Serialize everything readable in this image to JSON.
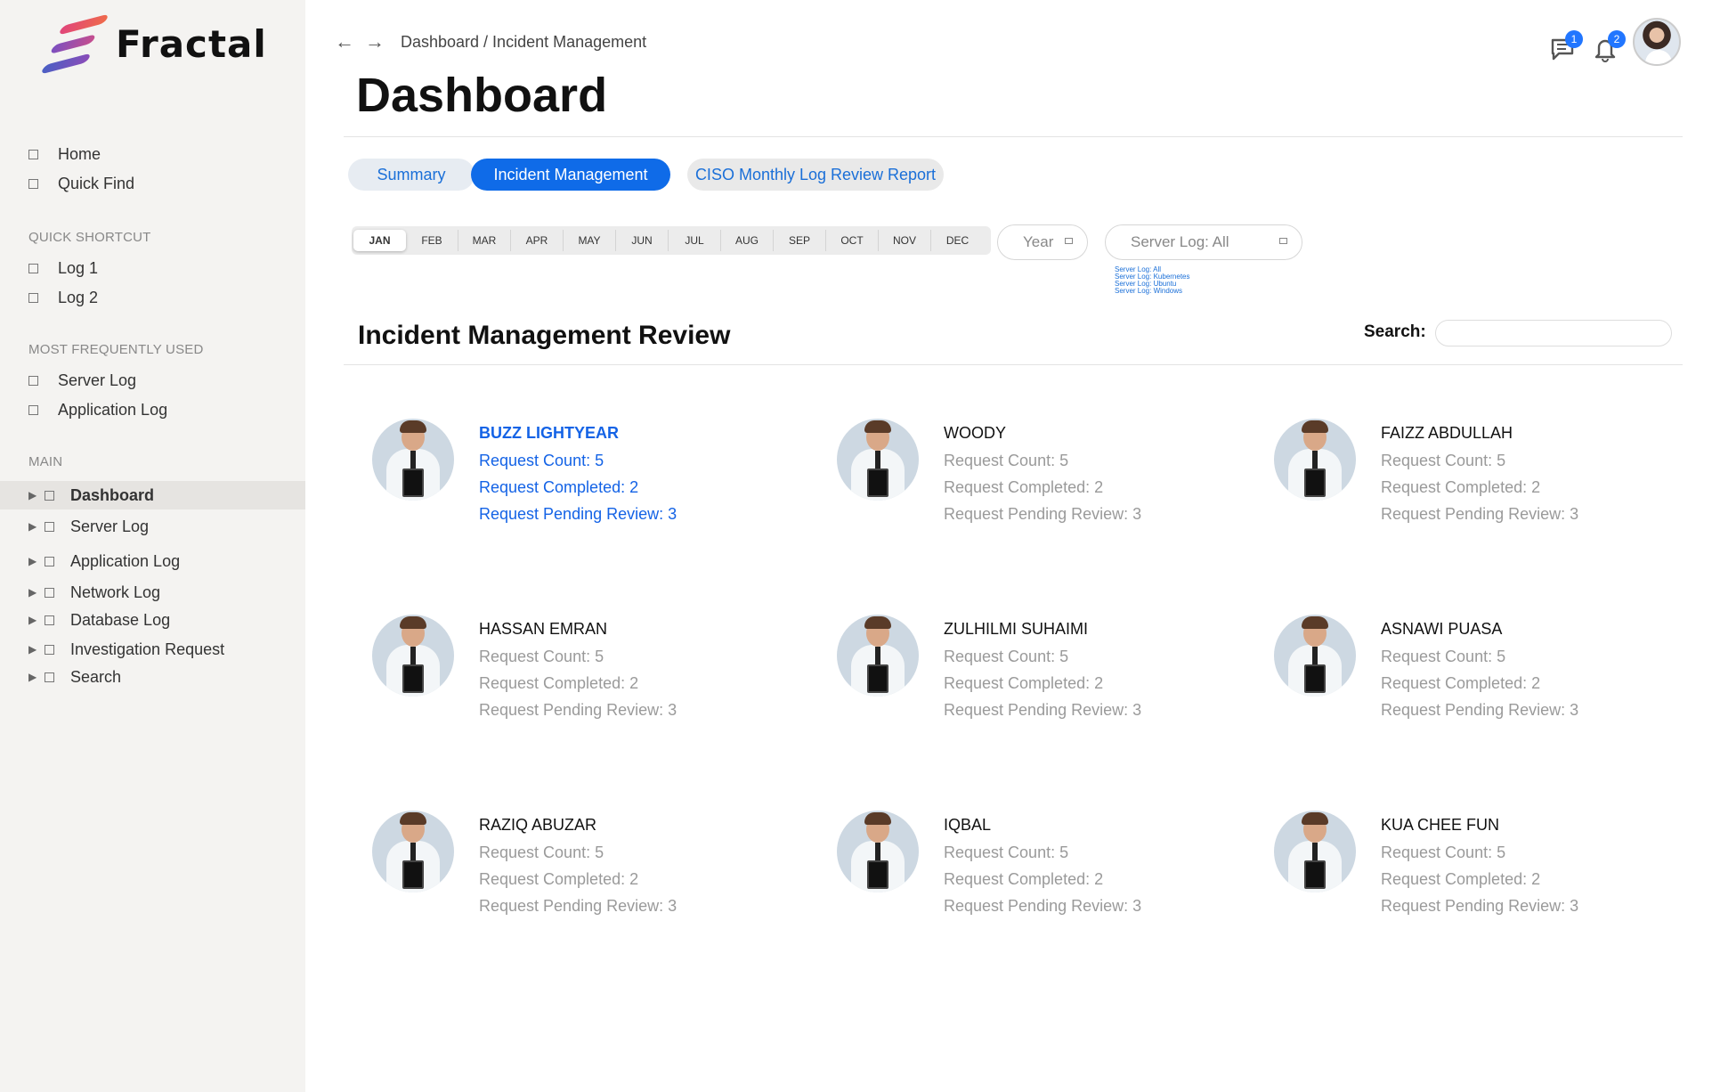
{
  "brand": {
    "name": "Fractal"
  },
  "sidebar": {
    "quick": [
      {
        "label": "Home"
      },
      {
        "label": "Quick Find"
      }
    ],
    "quick_shortcut": {
      "title": "QUICK SHORTCUT",
      "items": [
        {
          "label": "Log 1"
        },
        {
          "label": "Log 2"
        }
      ]
    },
    "most_used": {
      "title": "MOST FREQUENTLY USED",
      "items": [
        {
          "label": "Server Log"
        },
        {
          "label": "Application Log"
        }
      ]
    },
    "main": {
      "title": "MAIN",
      "items": [
        {
          "label": "Dashboard",
          "active": true
        },
        {
          "label": "Server Log"
        },
        {
          "label": "Application Log"
        },
        {
          "label": "Network Log"
        },
        {
          "label": "Database Log"
        },
        {
          "label": "Investigation Request"
        },
        {
          "label": "Search"
        }
      ]
    }
  },
  "header": {
    "breadcrumb": "Dashboard / Incident Management",
    "title": "Dashboard",
    "messages_count": "1",
    "notifications_count": "2"
  },
  "tabs": [
    {
      "label": "Summary"
    },
    {
      "label": "Incident Management",
      "active": true
    },
    {
      "label": "CISO Monthly Log Review Report"
    }
  ],
  "months": [
    "JAN",
    "FEB",
    "MAR",
    "APR",
    "MAY",
    "JUN",
    "JUL",
    "AUG",
    "SEP",
    "OCT",
    "NOV",
    "DEC"
  ],
  "selected_month": "JAN",
  "filters": {
    "year_placeholder": "Year",
    "server_log_value": "Server Log: All",
    "server_log_options": [
      "Server Log: All",
      "Server Log: Kubernetes",
      "Server Log: Ubuntu",
      "Server Log: Windows"
    ]
  },
  "section": {
    "title": "Incident Management Review",
    "search_label": "Search:"
  },
  "people": [
    {
      "name": "BUZZ LIGHTYEAR",
      "count": "Request Count: 5",
      "completed": "Request Completed: 2",
      "pending": "Request Pending Review: 3"
    },
    {
      "name": "WOODY",
      "count": "Request Count: 5",
      "completed": "Request Completed: 2",
      "pending": "Request Pending Review: 3"
    },
    {
      "name": "FAIZZ ABDULLAH",
      "count": "Request Count: 5",
      "completed": "Request Completed: 2",
      "pending": "Request Pending Review: 3"
    },
    {
      "name": "HASSAN EMRAN",
      "count": "Request Count: 5",
      "completed": "Request Completed: 2",
      "pending": "Request Pending Review: 3"
    },
    {
      "name": "ZULHILMI SUHAIMI",
      "count": "Request Count: 5",
      "completed": "Request Completed: 2",
      "pending": "Request Pending Review: 3"
    },
    {
      "name": "ASNAWI PUASA",
      "count": "Request Count: 5",
      "completed": "Request Completed: 2",
      "pending": "Request Pending Review: 3"
    },
    {
      "name": "RAZIQ ABUZAR",
      "count": "Request Count: 5",
      "completed": "Request Completed: 2",
      "pending": "Request Pending Review: 3"
    },
    {
      "name": "IQBAL",
      "count": "Request Count: 5",
      "completed": "Request Completed: 2",
      "pending": "Request Pending Review: 3"
    },
    {
      "name": "KUA CHEE FUN",
      "count": "Request Count: 5",
      "completed": "Request Completed: 2",
      "pending": "Request Pending Review: 3"
    }
  ]
}
